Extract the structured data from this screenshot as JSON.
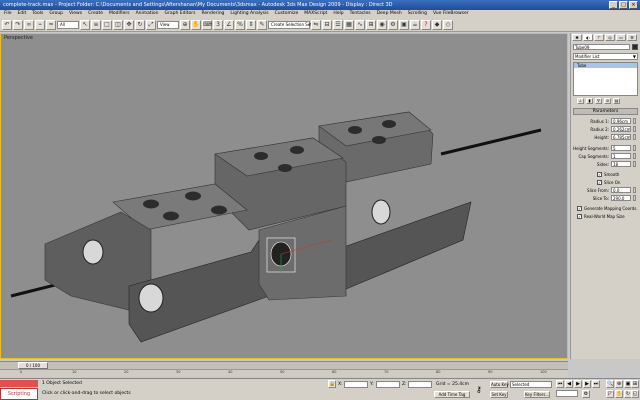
{
  "title_bar": {
    "text": "complete-track.max  -  Project Folder: C:\\Documents and Settings\\Aftershanan\\My Documents\\3dsmax  -  Autodesk 3ds Max Design 2009  -  Display : Direct 3D",
    "min": "_",
    "max": "□",
    "close": "×"
  },
  "menu": {
    "items": [
      "File",
      "Edit",
      "Tools",
      "Group",
      "Views",
      "Create",
      "Modifiers",
      "Animation",
      "Graph Editors",
      "Rendering",
      "Lighting Analysis",
      "Customize",
      "MAXScript",
      "Help",
      "Tentacles",
      "Deep Mesh",
      "Scrolling",
      "Vue FileBrowser"
    ]
  },
  "toolbar": {
    "selection_filter": "All",
    "reference_coord": "View",
    "named_selection": "Create Selection Set"
  },
  "viewport": {
    "label": "Perspective"
  },
  "command_panel": {
    "object_name": "Tube09",
    "modifier_list": "Modifier List",
    "stack_item": "Tube",
    "rollout_title": "Parameters",
    "params": [
      {
        "label": "Radius 1:",
        "value": "0.96cm"
      },
      {
        "label": "Radius 2:",
        "value": "0.262cm"
      },
      {
        "label": "Height:",
        "value": "6.785cm"
      },
      {
        "label": "Height Segments:",
        "value": "5"
      },
      {
        "label": "Cap Segments:",
        "value": "1"
      },
      {
        "label": "Sides:",
        "value": "18"
      }
    ],
    "smooth_label": "Smooth",
    "slice_on_label": "Slice On",
    "slice_params": [
      {
        "label": "Slice From:",
        "value": "0.0"
      },
      {
        "label": "Slice To:",
        "value": "290.0"
      }
    ],
    "gen_mapping_label": "Generate Mapping Coords.",
    "real_world_label": "Real-World Map Size"
  },
  "timeline": {
    "frame_display": "0 / 100",
    "ticks": [
      "0",
      "10",
      "20",
      "30",
      "40",
      "50",
      "60",
      "70",
      "80",
      "90",
      "100"
    ]
  },
  "status": {
    "maxscript_label": "Scripting",
    "selected_text": "1 Object Selected",
    "prompt_text": "Click or click-and-drag to select objects",
    "x_label": "X:",
    "y_label": "Y:",
    "z_label": "Z:",
    "grid": "Grid = 25.4cm",
    "add_time_tag": "Add Time Tag",
    "auto_key": "Auto Key",
    "set_key": "Set Key",
    "selected_dropdown": "Selected",
    "key_filters": "Key Filters..."
  },
  "colors": {
    "viewport_bg": "#8e8e8e",
    "active_border": "#e8c020",
    "title_bar": "#2a5aa8",
    "chain_face": "#707070"
  }
}
